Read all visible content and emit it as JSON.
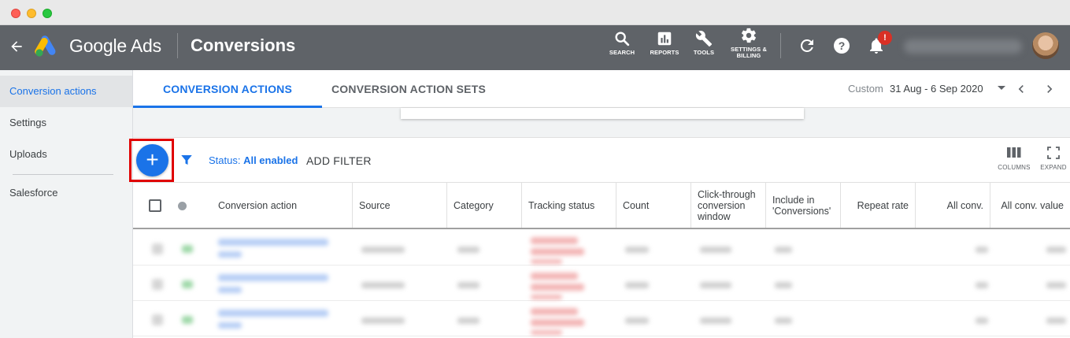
{
  "window": {
    "controls": [
      "close",
      "minimize",
      "maximize"
    ]
  },
  "header": {
    "back_icon": "arrow-left-icon",
    "brand": "Google Ads",
    "page_title": "Conversions",
    "tools": [
      {
        "label": "SEARCH",
        "icon": "search-icon"
      },
      {
        "label": "REPORTS",
        "icon": "bar-chart-icon"
      },
      {
        "label": "TOOLS",
        "icon": "wrench-icon"
      },
      {
        "label_line1": "SETTINGS &",
        "label_line2": "BILLING",
        "icon": "gear-icon"
      }
    ],
    "notification_badge": "!",
    "colors": {
      "bar": "#5f6368",
      "badge": "#d93025"
    }
  },
  "sidebar": {
    "items": [
      {
        "label": "Conversion actions",
        "active": true
      },
      {
        "label": "Settings"
      },
      {
        "label": "Uploads"
      },
      {
        "label": "Salesforce"
      }
    ]
  },
  "tabs": {
    "items": [
      {
        "label": "CONVERSION ACTIONS",
        "active": true
      },
      {
        "label": "CONVERSION ACTION SETS"
      }
    ]
  },
  "date_range": {
    "label": "Custom",
    "value": "31 Aug - 6 Sep 2020"
  },
  "toolbar": {
    "add_button": "+",
    "status_label": "Status: ",
    "status_value": "All enabled",
    "add_filter": "ADD FILTER",
    "columns": "COLUMNS",
    "expand": "EXPAND",
    "accent": "#1a73e8",
    "highlight": "#e00000"
  },
  "table": {
    "columns": [
      "Conversion action",
      "Source",
      "Category",
      "Tracking status",
      "Count",
      "Click-through conversion window",
      "Include in 'Conversions'",
      "Repeat rate",
      "All conv.",
      "All conv. value"
    ],
    "rows_note_blurred": true
  }
}
